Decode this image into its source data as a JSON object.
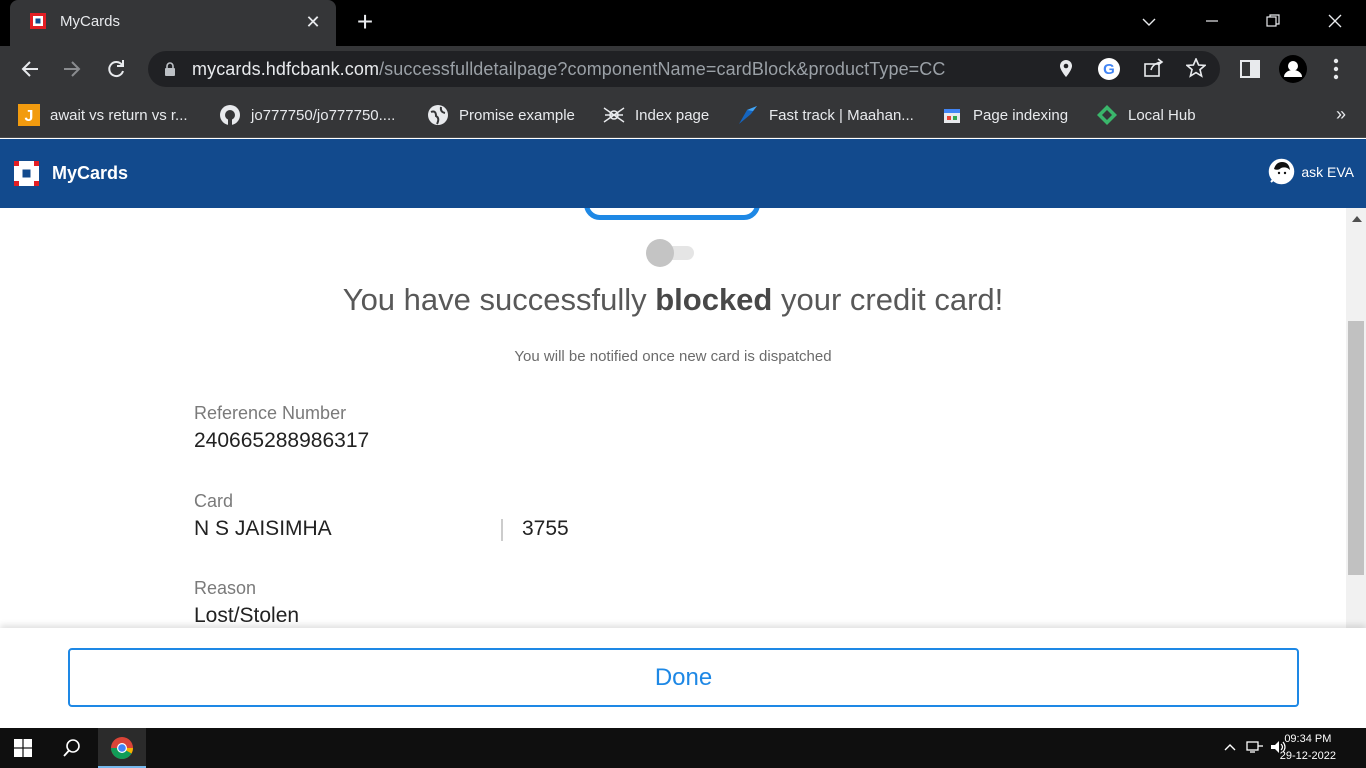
{
  "browser": {
    "tab_title": "MyCards",
    "url_host": "mycards.hdfcbank.com",
    "url_path": "/successfulldetailpage?componentName=cardBlock&productType=CC",
    "bookmarks": [
      {
        "label": "await vs return vs r...",
        "icon": "j-icon"
      },
      {
        "label": "jo777750/jo777750....",
        "icon": "github-icon"
      },
      {
        "label": "Promise example",
        "icon": "globe-icon"
      },
      {
        "label": "Index page",
        "icon": "spider-icon"
      },
      {
        "label": "Fast track | Maahan...",
        "icon": "fasttrack-icon"
      },
      {
        "label": "Page indexing",
        "icon": "page-icon"
      },
      {
        "label": "Local Hub",
        "icon": "diamond-icon"
      }
    ],
    "more_bookmarks": "»"
  },
  "app": {
    "title": "MyCards",
    "assistant": "ask EVA"
  },
  "result": {
    "headline_pre": "You have successfully ",
    "headline_bold": "blocked",
    "headline_post": " your credit card!",
    "subtext": "You will be notified once new card is dispatched",
    "reference_label": "Reference Number",
    "reference_value": "240665288986317",
    "card_label": "Card",
    "card_name": "N S JAISIMHA",
    "card_last4": "3755",
    "reason_label": "Reason",
    "reason_value": "Lost/Stolen",
    "toggle_on": false
  },
  "footer": {
    "done_label": "Done"
  },
  "taskbar": {
    "time": "09:34 PM",
    "date": "29-12-2022"
  },
  "colors": {
    "header": "#124a8d",
    "accent": "#1e88e5"
  }
}
